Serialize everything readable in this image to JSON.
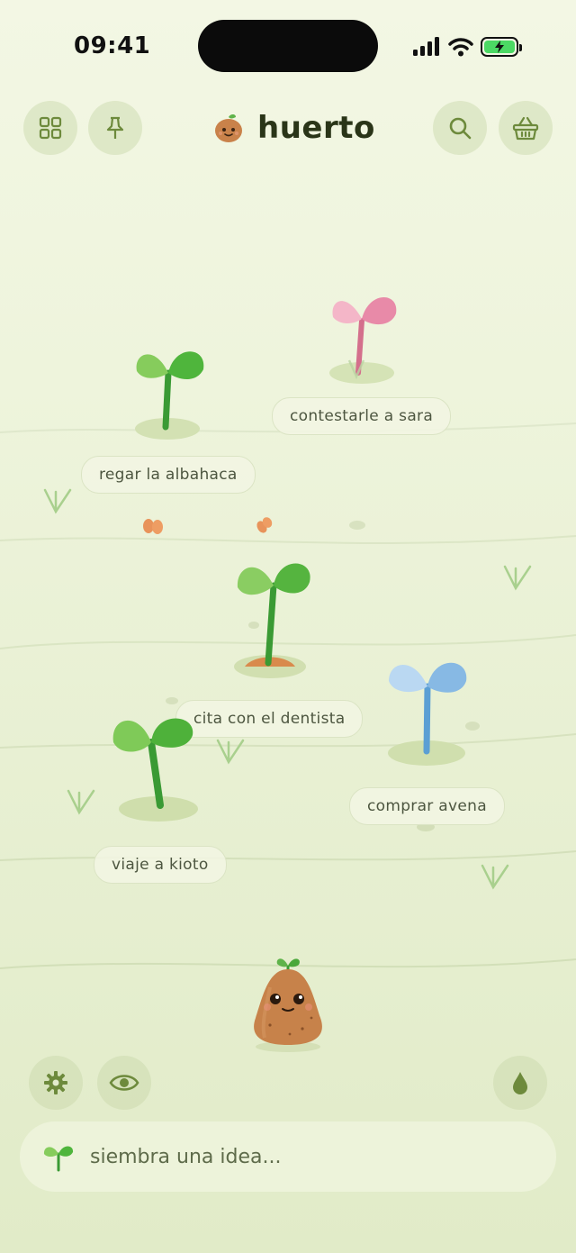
{
  "status_bar": {
    "time": "09:41"
  },
  "header": {
    "title": "huerto",
    "left_icons": [
      "grid-icon",
      "pin-icon"
    ],
    "right_icons": [
      "search-icon",
      "basket-icon"
    ]
  },
  "garden": {
    "plants": [
      {
        "label": "contestarle a sara",
        "color": "pink"
      },
      {
        "label": "regar la albahaca",
        "color": "green"
      },
      {
        "label": "cita con el dentista",
        "color": "green"
      },
      {
        "label": "comprar avena",
        "color": "blue"
      },
      {
        "label": "viaje a kioto",
        "color": "green"
      }
    ]
  },
  "bottom_bar": {
    "left_icons": [
      "gear-icon",
      "eye-icon"
    ],
    "right_icon": "water-drop-icon"
  },
  "input": {
    "placeholder": "siembra una idea..."
  },
  "colors": {
    "leaf_green": "#5bb84a",
    "stem_green": "#3a9a34",
    "leaf_pink": "#ec8fae",
    "leaf_blue": "#8cbde6",
    "potato": "#c9824a"
  }
}
